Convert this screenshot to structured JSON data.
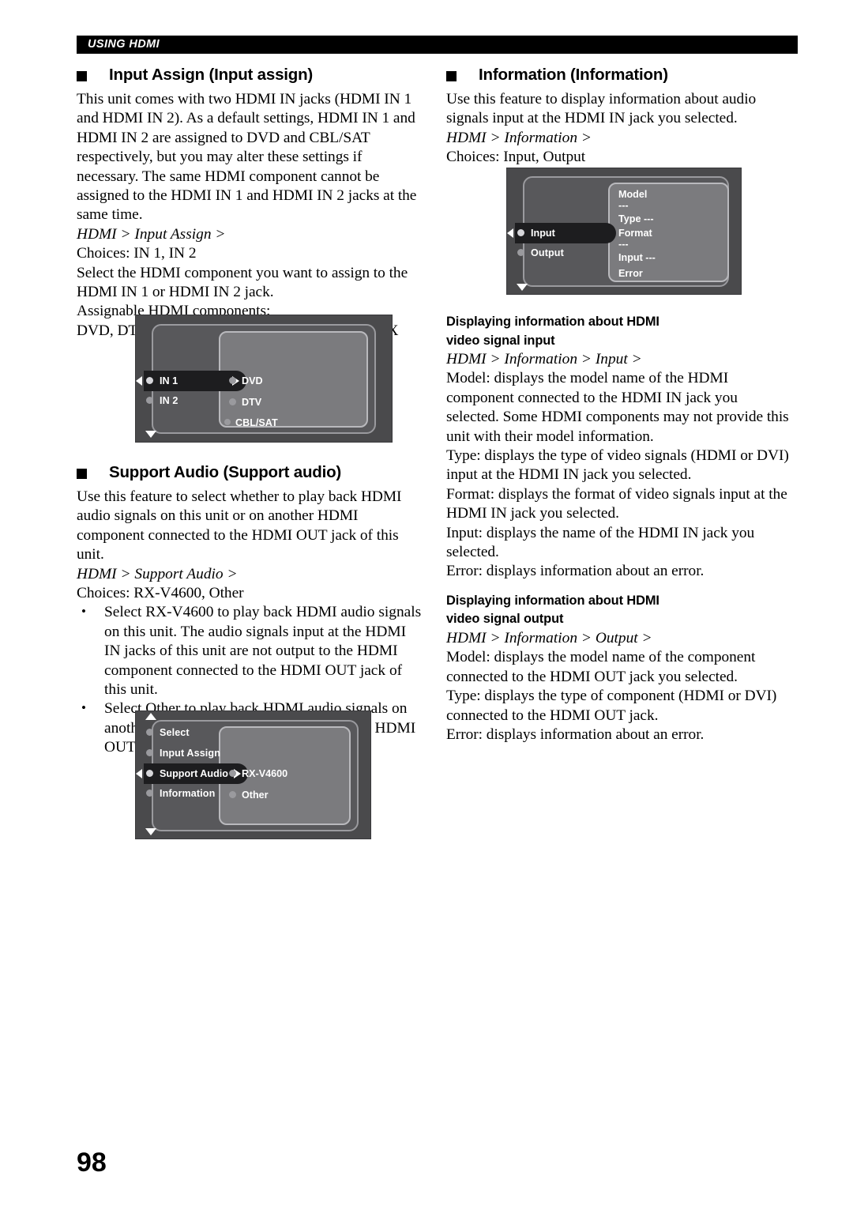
{
  "header": {
    "running_title": "USING HDMI"
  },
  "page_number": "98",
  "left_column": {
    "section1": {
      "heading": "Input Assign (Input assign)",
      "para1": "This unit comes with two HDMI IN jacks (HDMI IN 1 and HDMI IN 2). As a default settings, HDMI IN 1 and HDMI IN 2 are assigned to DVD and CBL/SAT respectively, but you may alter these settings if necessary. The same HDMI component cannot be assigned to the HDMI IN 1 and HDMI IN 2 jacks at the same time.",
      "path": "HDMI > Input Assign >",
      "choices": "Choices: IN 1, IN 2",
      "para2": "Select the HDMI component you want to assign to the HDMI IN 1 or HDMI IN 2 jack.",
      "para3": "Assignable HDMI components:",
      "para4": "DVD, DTV, CBL/SAT, VCR1, DVR/VCR2, V-AUX"
    },
    "section2": {
      "heading": "Support Audio (Support audio)",
      "para1": "Use this feature to select whether to play back HDMI audio signals on this unit or on another HDMI component connected to the HDMI OUT jack of this unit.",
      "path": "HDMI > Support Audio >",
      "choices": "Choices: RX-V4600, Other",
      "bullets": [
        "Select RX-V4600 to play back HDMI audio signals on this unit. The audio signals input at the HDMI IN jacks of this unit are not output to the HDMI component connected to the HDMI OUT jack of this unit.",
        "Select Other to play back HDMI audio signals on another HDMI component connected to the HDMI OUT jack of this unit."
      ]
    }
  },
  "right_column": {
    "section1": {
      "heading": "Information (Information)",
      "para1": "Use this feature to display information about audio signals input at the HDMI IN jack you selected.",
      "path": "HDMI > Information >",
      "choices": "Choices: Input, Output"
    },
    "subsection_input": {
      "heading_line1": "Displaying information about HDMI",
      "heading_line2": "video signal input",
      "path": "HDMI > Information > Input >",
      "para_model": "Model: displays the model name of the HDMI component connected to the HDMI IN jack you selected. Some HDMI components may not provide this unit with their model information.",
      "para_type": "Type: displays the type of video signals (HDMI or DVI) input at the HDMI IN jack you selected.",
      "para_format": "Format: displays the format of video signals input at the HDMI IN jack you selected.",
      "para_input": "Input: displays the name of the HDMI IN jack you selected.",
      "para_error": "Error: displays information about an error."
    },
    "subsection_output": {
      "heading_line1": "Displaying information about HDMI",
      "heading_line2": "video signal output",
      "path": "HDMI > Information > Output >",
      "para_model": "Model: displays the model name of the component connected to the HDMI OUT jack you selected.",
      "para_type": "Type: displays the type of component (HDMI or DVI) connected to the HDMI OUT jack.",
      "para_error": "Error: displays information about an error."
    }
  },
  "diagrams": {
    "input_assign_menu": {
      "left_items": [
        "IN 1",
        "IN 2"
      ],
      "selected_left": "IN 1",
      "right_items": [
        "DVD",
        "DTV",
        "CBL/SAT"
      ],
      "scroll_down_icon": "triangle-down-icon",
      "cursor_left_icon": "triangle-left-icon",
      "cursor_right_icon": "triangle-right-icon"
    },
    "support_audio_menu": {
      "left_items": [
        "Select",
        "Input Assign",
        "Support Audio",
        "Information"
      ],
      "selected_left": "Support Audio",
      "right_items": [
        "RX-V4600",
        "Other"
      ],
      "scroll_up_icon": "triangle-up-icon",
      "scroll_down_icon": "triangle-down-icon",
      "cursor_left_icon": "triangle-left-icon",
      "cursor_right_icon": "triangle-right-icon"
    },
    "information_menu": {
      "left_items": [
        "Input",
        "Output"
      ],
      "selected_left": "Input",
      "right_items": [
        "Model",
        "---",
        "Type  ---",
        "Format",
        "---",
        "Input  ---",
        "Error"
      ],
      "scroll_down_icon": "triangle-down-icon",
      "cursor_left_icon": "triangle-left-icon"
    }
  },
  "colors": {
    "header_bar": "#000000",
    "osd_frame": "#4a4a4c",
    "osd_panel": "#58585b",
    "osd_right_panel": "#7b7b7e",
    "osd_highlight": "#1d1d1f",
    "osd_text": "#ffffff"
  }
}
